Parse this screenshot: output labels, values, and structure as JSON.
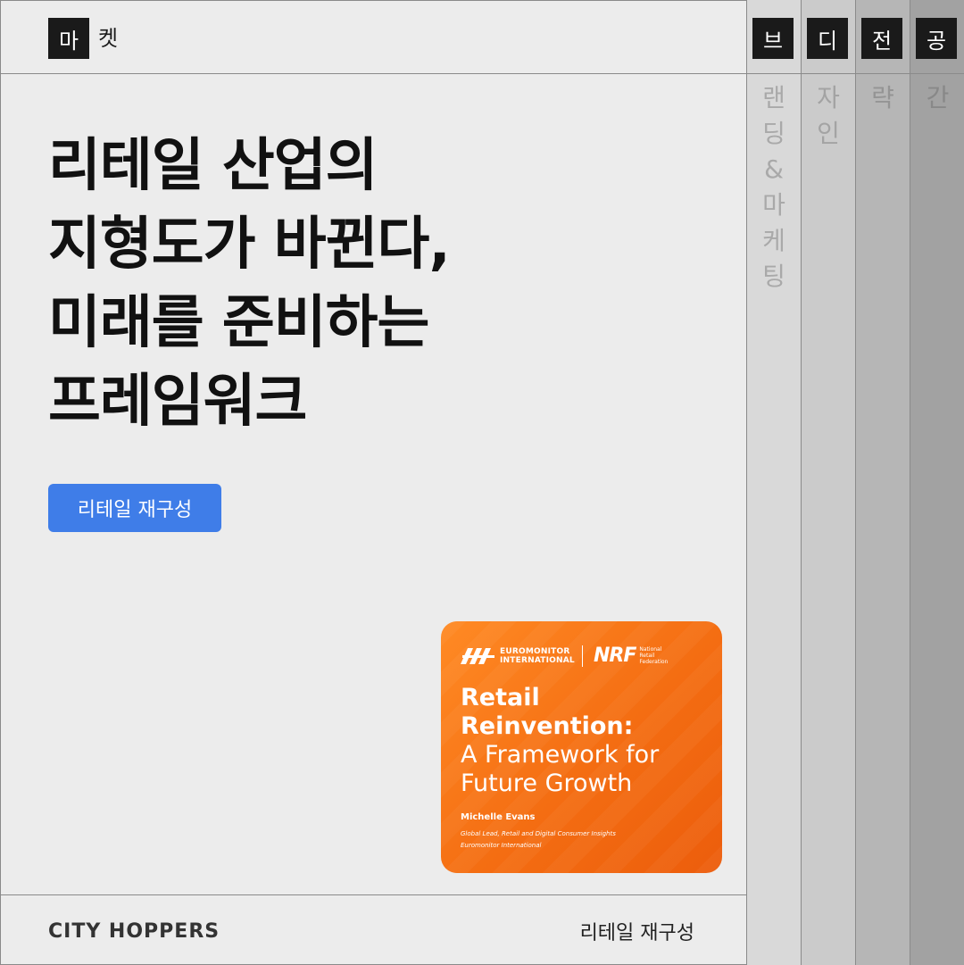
{
  "header": {
    "box_char": "마",
    "rest_char": "켓"
  },
  "columns": [
    {
      "tab": "브",
      "vertical_chars": [
        "랜",
        "딩",
        "&",
        "마",
        "케",
        "팅"
      ]
    },
    {
      "tab": "디",
      "vertical_chars": [
        "자",
        "인"
      ]
    },
    {
      "tab": "전",
      "vertical_chars": [
        "략"
      ]
    },
    {
      "tab": "공",
      "vertical_chars": [
        "간"
      ]
    }
  ],
  "headline": {
    "lines": [
      "리테일 산업의",
      "지형도가 바뀐다,",
      "미래를 준비하는",
      "프레임워크"
    ]
  },
  "tag": {
    "label": "리테일 재구성",
    "color": "#3f7de8"
  },
  "report": {
    "logo_left_line1": "EUROMONITOR",
    "logo_left_line2": "INTERNATIONAL",
    "logo_right": "NRF",
    "logo_right_sub1": "National",
    "logo_right_sub2": "Retail",
    "logo_right_sub3": "Federation",
    "title_line1": "Retail",
    "title_line2": "Reinvention:",
    "subtitle_line1": "A Framework for",
    "subtitle_line2": "Future Growth",
    "author": "Michelle Evans",
    "role_line1": "Global Lead, Retail and Digital Consumer Insights",
    "role_line2": "Euromonitor International",
    "color": "#f46d12"
  },
  "footer": {
    "brand": "CITY HOPPERS",
    "right_label": "리테일 재구성"
  }
}
